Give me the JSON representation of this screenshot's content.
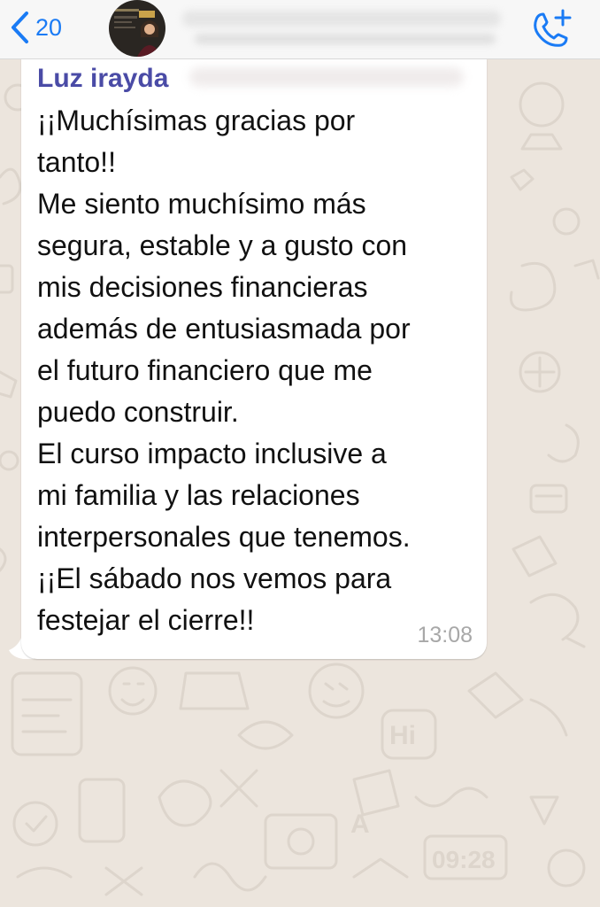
{
  "header": {
    "back_count": "20",
    "back_icon": "chevron-left-icon",
    "call_icon": "phone-add-icon",
    "accent_color": "#1a7bf5"
  },
  "message": {
    "sender": "Luz irayda",
    "sender_color": "#4a4ba6",
    "lines": [
      "¡¡Muchísimas gracias por",
      "tanto!!",
      "Me siento muchísimo más",
      "segura, estable y a gusto con",
      "mis decisiones financieras",
      "además  de entusiasmada por",
      "el futuro financiero que me",
      "puedo construir.",
      "El curso impacto inclusive a",
      "mi familia y las relaciones",
      "interpersonales que tenemos.",
      "¡¡El sábado nos vemos para",
      "festejar el cierre!!"
    ],
    "time": "13:08"
  },
  "wallpaper": {
    "background": "#ece5dd",
    "doodle_color": "#ddd5cc",
    "doodle_texts": [
      "Hi",
      "09:28",
      "A"
    ]
  }
}
